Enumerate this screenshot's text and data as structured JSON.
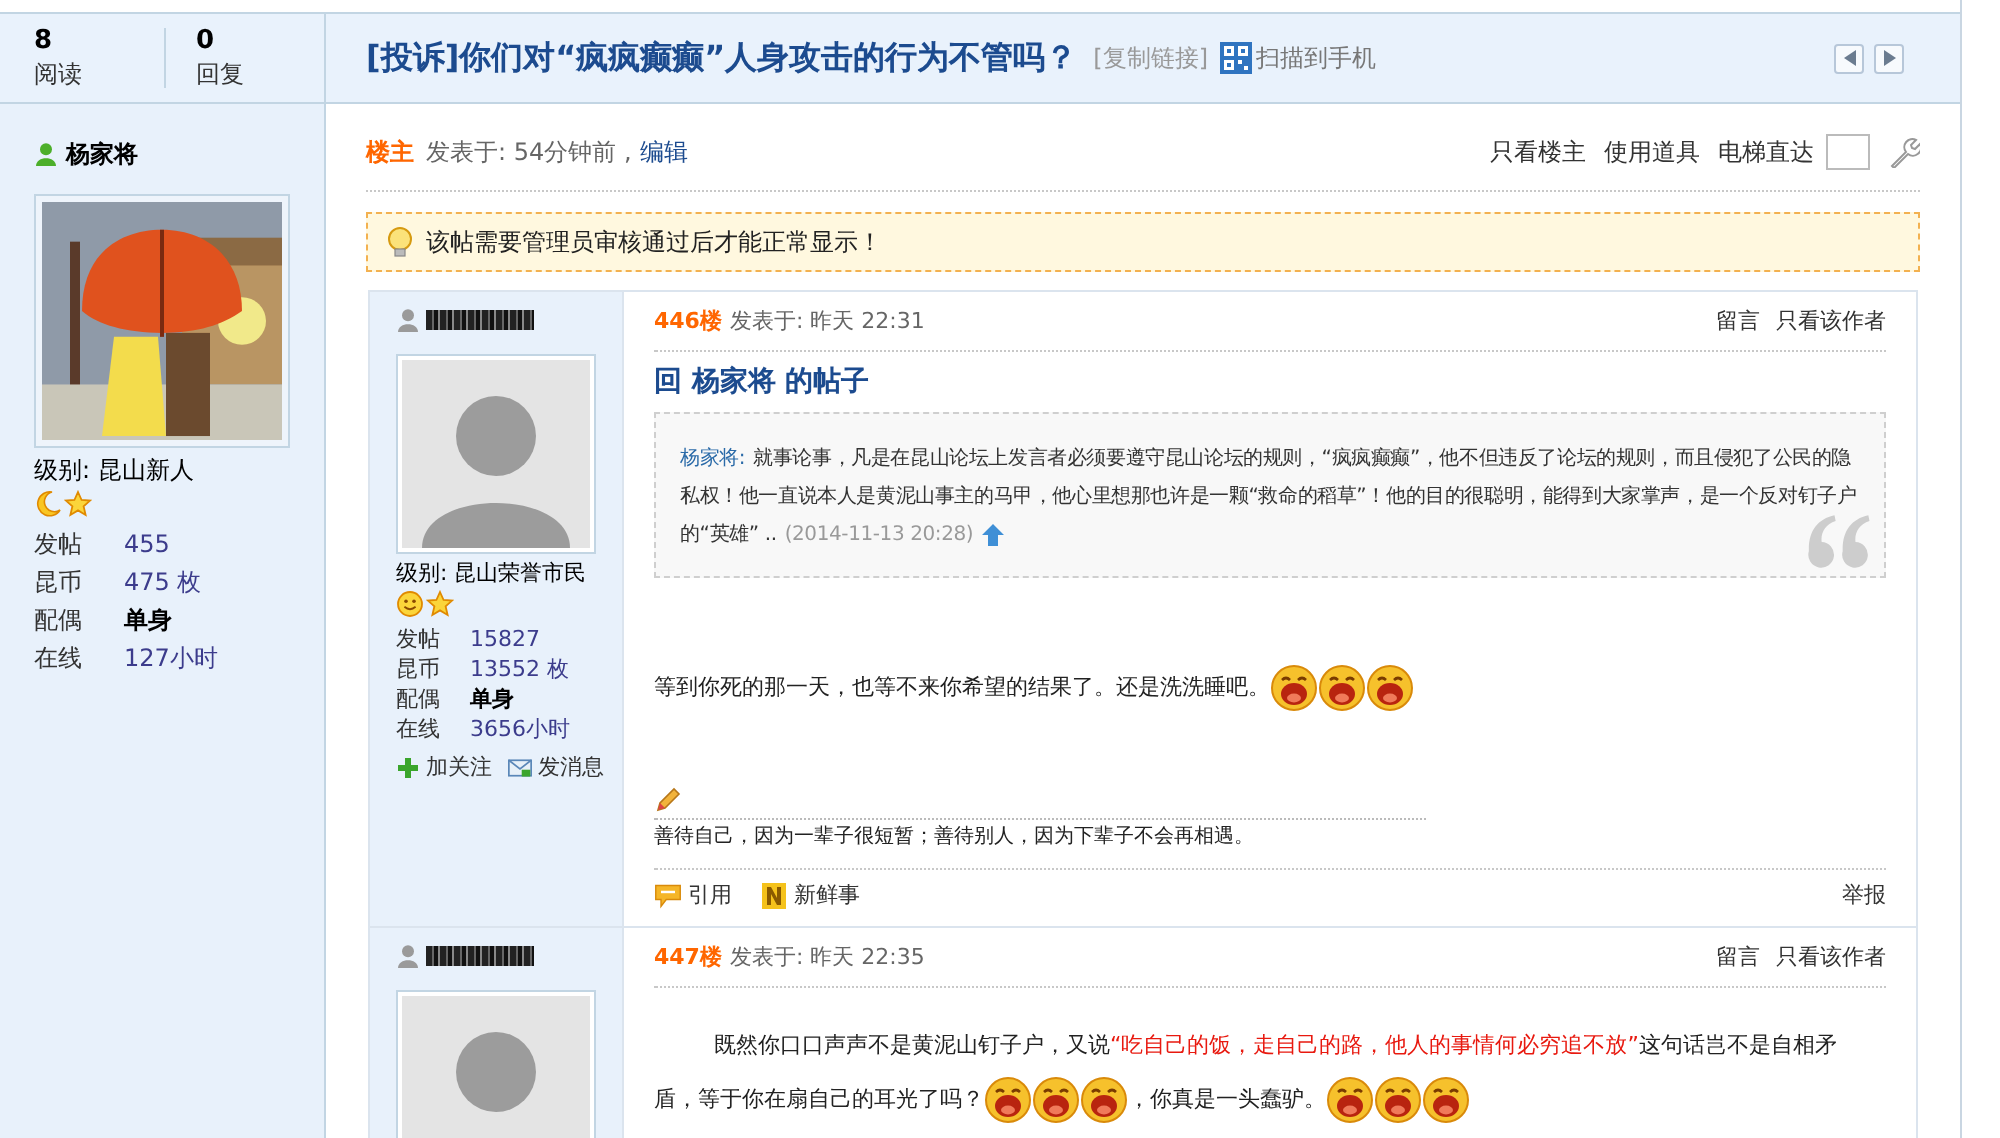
{
  "header": {
    "stats": [
      {
        "value": "8",
        "label": "阅读"
      },
      {
        "value": "0",
        "label": "回复"
      }
    ],
    "title": "[投诉]你们对“疯疯癫癫”人身攻击的行为不管吗？",
    "copy_link": "[复制链接]",
    "scan_link": "扫描到手机"
  },
  "author": {
    "name": "杨家将",
    "level": "级别: 昆山新人",
    "rank_icons": [
      {
        "kind": "moon"
      },
      {
        "kind": "star"
      }
    ],
    "stats": [
      {
        "label": "发帖",
        "value": "455",
        "kind": "link"
      },
      {
        "label": "昆币",
        "value": "475 枚",
        "kind": "link"
      },
      {
        "label": "配偶",
        "value": "单身",
        "kind": "text"
      },
      {
        "label": "在线",
        "value": "127小时",
        "kind": "link"
      }
    ]
  },
  "post": {
    "floor": "楼主",
    "posted": "发表于: 54分钟前 ,",
    "edit": "编辑",
    "actions": [
      "只看楼主",
      "使用道具"
    ],
    "jump_label": "电梯直达",
    "notice": "该帖需要管理员审核通过后才能正常显示！"
  },
  "replies": [
    {
      "floor": "446楼",
      "posted": "发表于: 昨天 22:31",
      "actions": [
        "留言",
        "只看该作者"
      ],
      "level": "级别: 昆山荣誉市民",
      "rank_icons": [
        {
          "kind": "smiley"
        },
        {
          "kind": "star"
        }
      ],
      "stats": [
        {
          "label": "发帖",
          "value": "15827",
          "kind": "link"
        },
        {
          "label": "昆币",
          "value": "13552 枚",
          "kind": "link"
        },
        {
          "label": "配偶",
          "value": "单身",
          "kind": "text"
        },
        {
          "label": "在线",
          "value": "3656小时",
          "kind": "link"
        }
      ],
      "user_actions": [
        {
          "kind": "follow",
          "label": "加关注"
        },
        {
          "kind": "message",
          "label": "发消息"
        }
      ],
      "title": "回 杨家将 的帖子",
      "quote": {
        "author": "杨家将:",
        "lines": [
          "就事论事，凡是在昆山论坛上发言者必须要遵守昆山论坛的规则，“疯疯癫癫”，他不但违反了论坛的规则，而且侵犯了公民的隐",
          "私权！他一直说本人是黄泥山事主的马甲，他心里想那也许是一颗“救命的稻草”！他的目的很聪明，能得到大家掌声，是一个反对钉子户",
          "的“英雄” .."
        ],
        "date": "(2014-11-13 20:28)"
      },
      "body": {
        "indented": false,
        "lines": [
          [
            {
              "kind": "text",
              "text": "等到你死的那一天，也等不来你希望的结果了。还是洗洗睡吧。"
            },
            {
              "kind": "emoji"
            },
            {
              "kind": "emoji"
            },
            {
              "kind": "emoji"
            }
          ]
        ]
      },
      "signature": "善待自己，因为一辈子很短暂；善待别人，因为下辈子不会再相遇。",
      "footer": {
        "actions": [
          {
            "kind": "quote",
            "label": "引用"
          },
          {
            "kind": "share",
            "label": "新鲜事"
          }
        ],
        "report": "举报"
      }
    },
    {
      "floor": "447楼",
      "posted": "发表于: 昨天 22:35",
      "actions": [
        "留言",
        "只看该作者"
      ],
      "body": {
        "indented": true,
        "lines": [
          [
            {
              "kind": "text",
              "text": "既然你口口声声不是黄泥山钉子户，又说"
            },
            {
              "kind": "highlight",
              "text": "“吃自己的饭，走自己的路，他人的事情何必穷追不放”"
            },
            {
              "kind": "text",
              "text": "这句话岂不是自相矛"
            }
          ],
          [
            {
              "kind": "text",
              "text": "盾，等于你在扇自己的耳光了吗？"
            },
            {
              "kind": "emoji"
            },
            {
              "kind": "emoji"
            },
            {
              "kind": "emoji"
            },
            {
              "kind": "text",
              "text": "，你真是一头蠢驴。"
            },
            {
              "kind": "emoji"
            },
            {
              "kind": "emoji"
            },
            {
              "kind": "emoji"
            }
          ]
        ]
      }
    }
  ]
}
